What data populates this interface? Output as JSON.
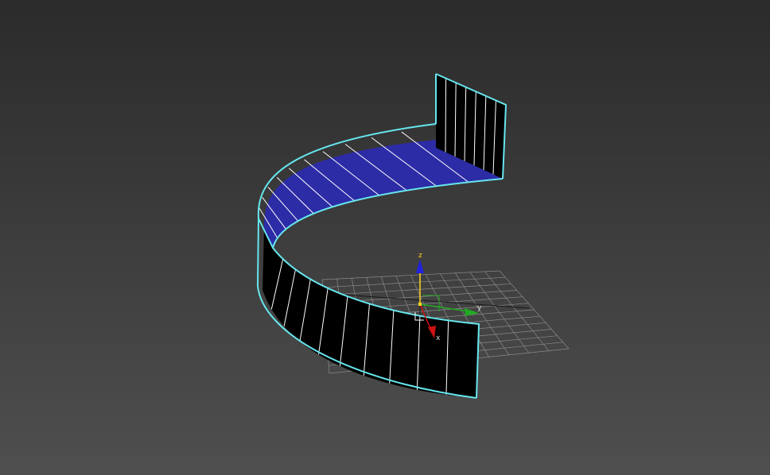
{
  "viewport": {
    "background_top": "#2b2b2b",
    "background_bottom": "#4f4f4f",
    "grid_color": "#8a8a8a"
  },
  "object": {
    "selection_outline_color": "#66e6ee",
    "inner_face_color": "#2c2ca6",
    "outer_face_color": "#000000",
    "segment_line_color": "#ffffff"
  },
  "gizmo": {
    "z_label": "z",
    "y_label": "y",
    "x_label": "x",
    "z_color": "#2222dd",
    "y_color": "#22aa22",
    "x_color": "#cc1111",
    "z_axis_line_color": "#ffd21e"
  }
}
